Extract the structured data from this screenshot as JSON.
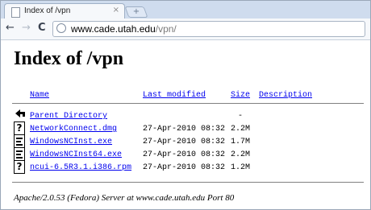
{
  "browser": {
    "tab_title": "Index of /vpn",
    "tab_close": "×",
    "new_tab": "+",
    "nav": {
      "back": "←",
      "forward": "→",
      "reload": "C"
    },
    "url_host": "www.cade.utah.edu",
    "url_path": "/vpn/"
  },
  "page": {
    "heading": "Index of /vpn",
    "columns": {
      "name": "Name",
      "last_modified": "Last modified",
      "size": "Size",
      "description": "Description"
    },
    "parent": {
      "name": "Parent Directory",
      "size": "-"
    },
    "files": [
      {
        "name": "NetworkConnect.dmg",
        "modified": "27-Apr-2010 08:32",
        "size": "2.2M",
        "icon": "unknown-file-icon"
      },
      {
        "name": "WindowsNCInst.exe",
        "modified": "27-Apr-2010 08:32",
        "size": "1.7M",
        "icon": "binary-file-icon"
      },
      {
        "name": "WindowsNCInst64.exe",
        "modified": "27-Apr-2010 08:32",
        "size": "2.2M",
        "icon": "binary-file-icon"
      },
      {
        "name": "ncui-6.5R3.1.i386.rpm",
        "modified": "27-Apr-2010 08:32",
        "size": "1.2M",
        "icon": "unknown-file-icon"
      }
    ],
    "address": "Apache/2.0.53 (Fedora) Server at www.cade.utah.edu Port 80"
  }
}
